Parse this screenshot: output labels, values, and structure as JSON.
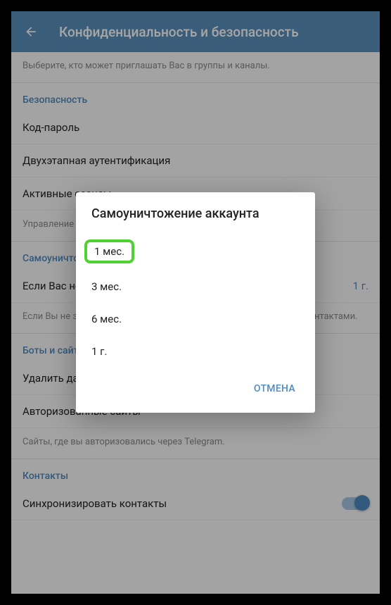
{
  "header": {
    "title": "Конфиденциальность и безопасность"
  },
  "groups_hint": "Выберите, кто может приглашать Вас в группы и каналы.",
  "security": {
    "title": "Безопасность",
    "passcode": "Код-пароль",
    "two_step": "Двухэтапная аутентификация",
    "active_sessions": "Активные сеансы",
    "manage_hint": "Управление сеансами"
  },
  "self_destruct": {
    "title": "Самоуничтожение аккаунта",
    "if_away_label": "Если Вас нет",
    "if_away_value": "1 г.",
    "hint": "Если Вы не заходите в аккаунт, он будет удалён вместе со всеми контактами."
  },
  "bots": {
    "title": "Боты и сайты",
    "clear_payments": "Удалить данные о платежах и доставке",
    "authorized_sites": "Авторизованные сайты",
    "hint": "Сайты, где вы авторизовались через Telegram."
  },
  "contacts": {
    "title": "Контакты",
    "sync": "Синхронизировать контакты"
  },
  "dialog": {
    "title": "Самоуничтожение аккаунта",
    "options": [
      "1 мес.",
      "3 мес.",
      "6 мес.",
      "1 г."
    ],
    "selected_index": 0,
    "cancel": "ОТМЕНА"
  }
}
